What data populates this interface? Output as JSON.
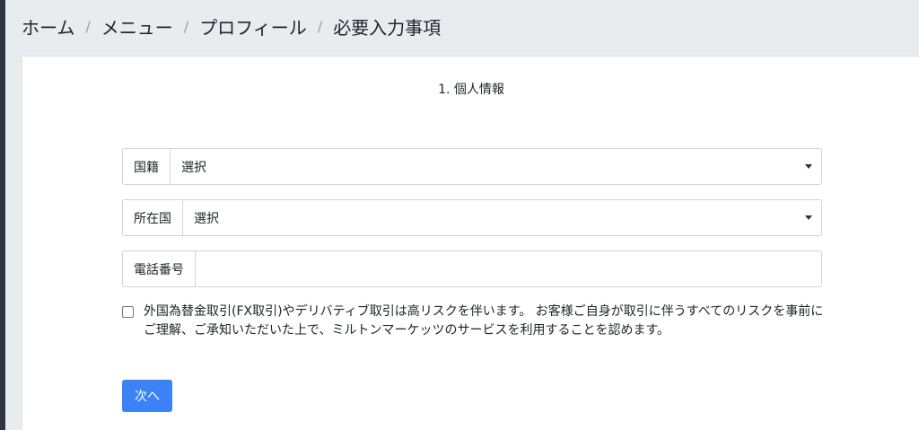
{
  "breadcrumb": {
    "items": [
      "ホーム",
      "メニュー",
      "プロフィール",
      "必要入力事項"
    ],
    "separator": "/"
  },
  "form": {
    "section_title": "1. 個人情報",
    "nationality": {
      "label": "国籍",
      "value": "選択"
    },
    "residence": {
      "label": "所在国",
      "value": "選択"
    },
    "phone": {
      "label": "電話番号",
      "value": ""
    },
    "consent_text": "外国為替金取引(FX取引)やデリバティブ取引は高リスクを伴います。 お客様ご自身が取引に伴うすべてのリスクを事前にご理解、ご承知いただいた上で、ミルトンマーケッツのサービスを利用することを認めます。",
    "next_label": "次へ"
  },
  "colors": {
    "background": "#e9ecef",
    "card": "#ffffff",
    "primary_button": "#3b82f6"
  }
}
